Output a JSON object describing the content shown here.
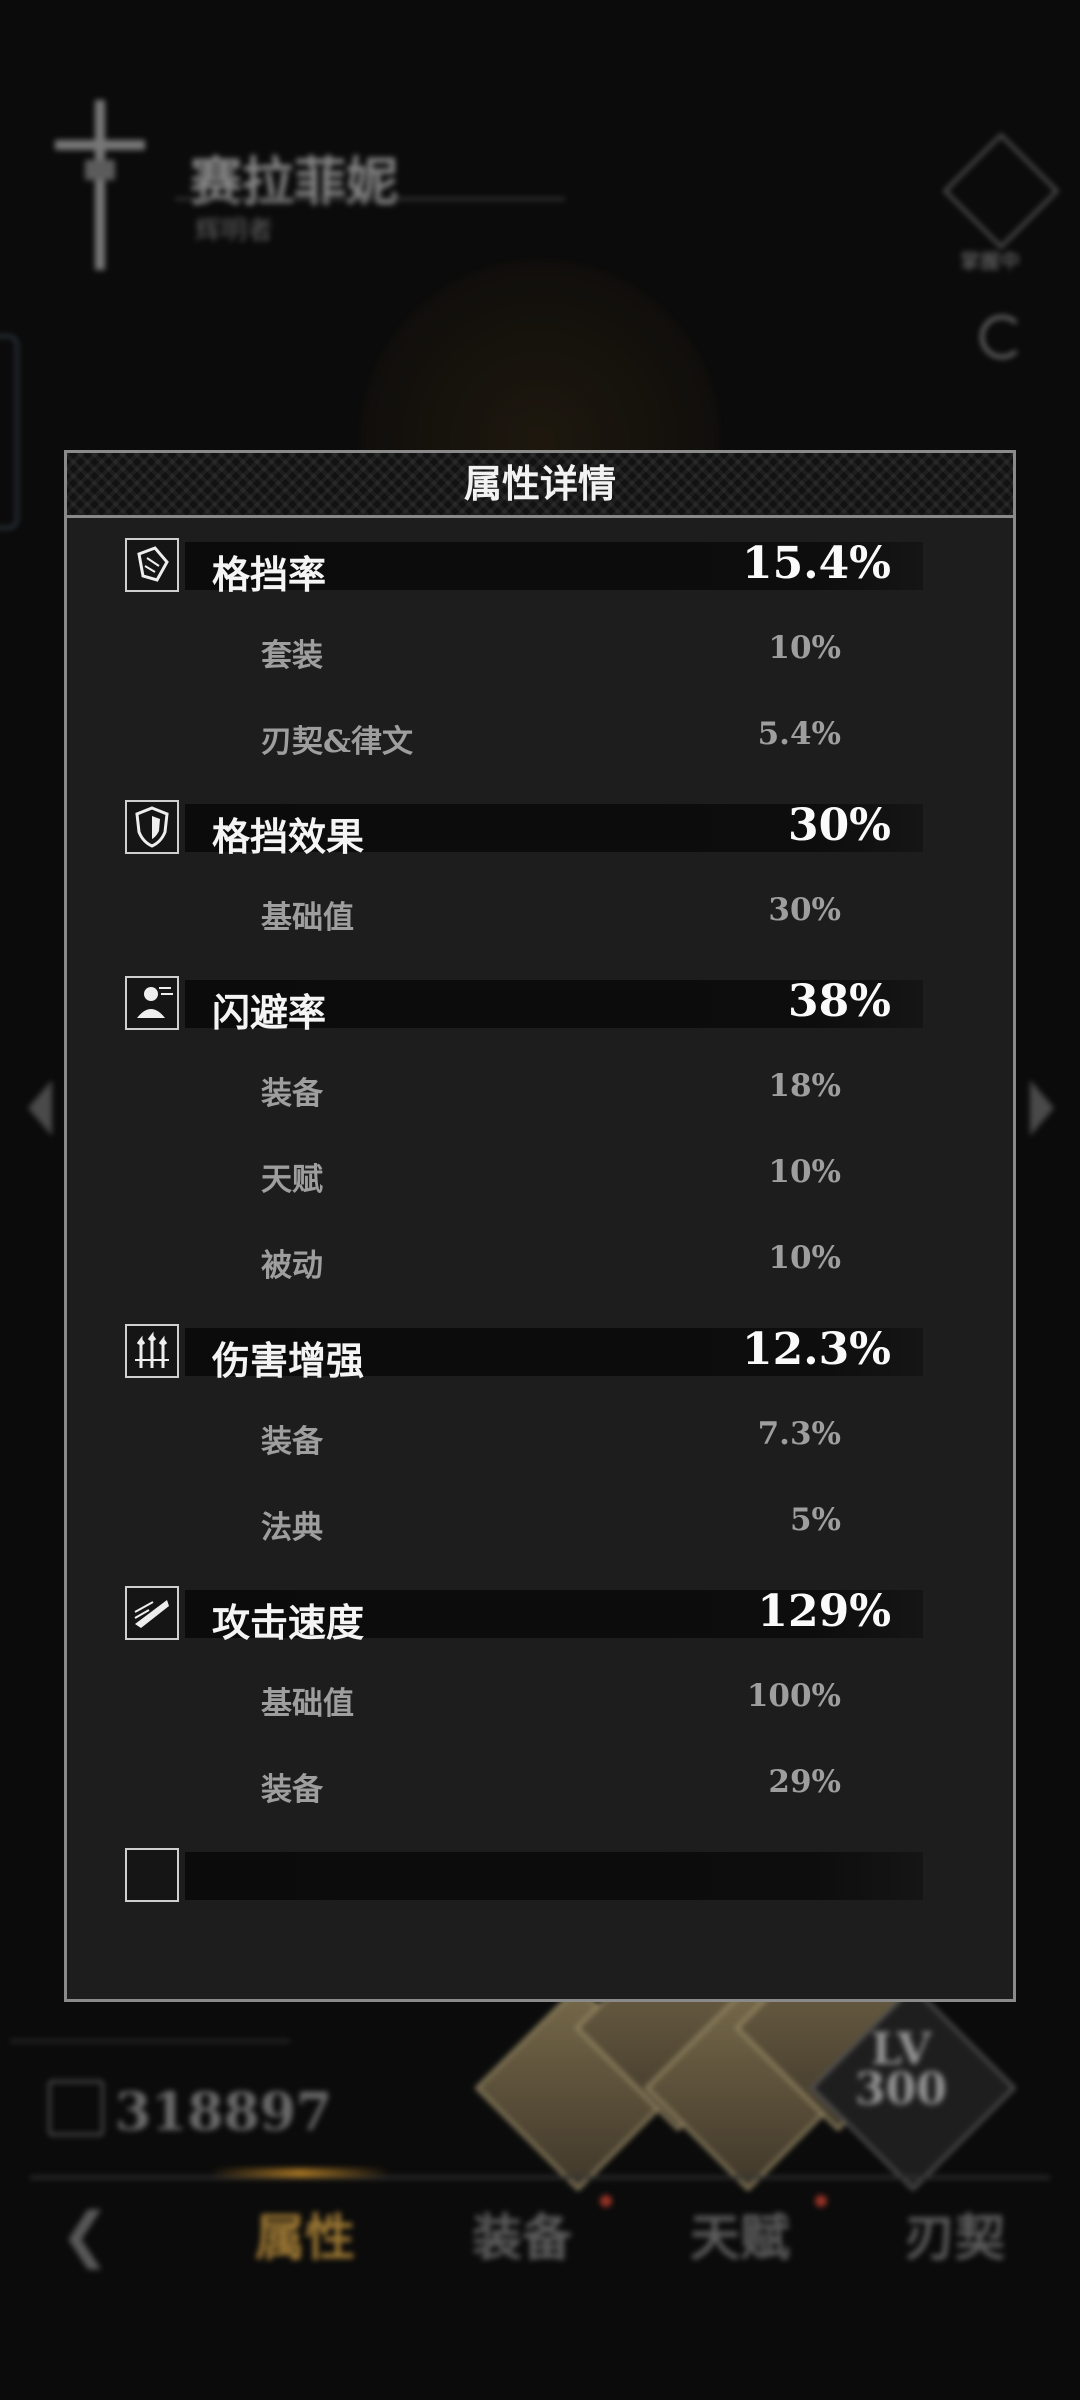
{
  "background": {
    "character_name": "赛拉菲妮",
    "character_subtitle": "辉明者",
    "top_right_badge": "掌握中",
    "score": "318897",
    "level_tile": "LV\n300",
    "nav": {
      "items": [
        {
          "label": "属性",
          "active": true
        },
        {
          "label": "装备",
          "badge": true
        },
        {
          "label": "天赋",
          "badge": true
        },
        {
          "label": "刃契"
        }
      ]
    }
  },
  "modal": {
    "title": "属性详情",
    "groups": [
      {
        "icon": "block-rate-icon",
        "label": "格挡率",
        "value": "15.4%",
        "subs": [
          {
            "label": "套装",
            "value": "10%"
          },
          {
            "label": "刃契&律文",
            "value": "5.4%"
          }
        ]
      },
      {
        "icon": "shield-icon",
        "label": "格挡效果",
        "value": "30%",
        "subs": [
          {
            "label": "基础值",
            "value": "30%"
          }
        ]
      },
      {
        "icon": "dodge-icon",
        "label": "闪避率",
        "value": "38%",
        "subs": [
          {
            "label": "装备",
            "value": "18%"
          },
          {
            "label": "天赋",
            "value": "10%"
          },
          {
            "label": "被动",
            "value": "10%"
          }
        ]
      },
      {
        "icon": "damage-boost-icon",
        "label": "伤害增强",
        "value": "12.3%",
        "subs": [
          {
            "label": "装备",
            "value": "7.3%"
          },
          {
            "label": "法典",
            "value": "5%"
          }
        ]
      },
      {
        "icon": "attack-speed-icon",
        "label": "攻击速度",
        "value": "129%",
        "subs": [
          {
            "label": "基础值",
            "value": "100%"
          },
          {
            "label": "装备",
            "value": "29%"
          }
        ]
      },
      {
        "icon": "partial-icon",
        "label": "",
        "value": "",
        "subs": []
      }
    ]
  }
}
